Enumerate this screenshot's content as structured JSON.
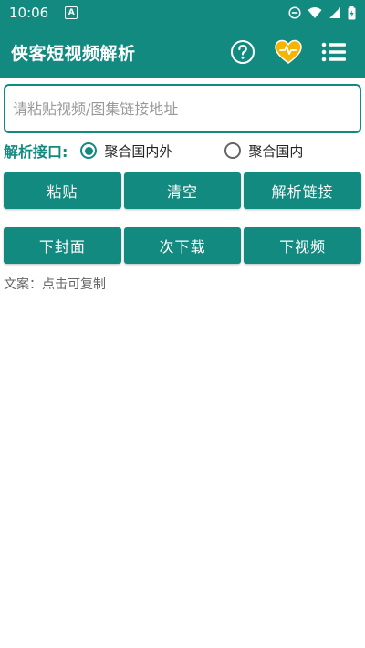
{
  "status_bar": {
    "time": "10:06",
    "a_badge": "A",
    "icons": [
      "a-icon",
      "do-not-disturb-icon",
      "wifi-icon",
      "signal-icon",
      "battery-icon"
    ]
  },
  "app_bar": {
    "title": "侠客短视频解析",
    "actions": [
      "help-icon",
      "heart-icon",
      "list-icon"
    ]
  },
  "url_input": {
    "value": "",
    "placeholder": "请粘贴视频/图集链接地址"
  },
  "api": {
    "label": "解析接口:",
    "options": [
      {
        "label": "聚合国内外",
        "selected": true
      },
      {
        "label": "聚合国内",
        "selected": false
      }
    ]
  },
  "actions_row1": {
    "paste": "粘贴",
    "clear": "清空",
    "parse": "解析链接"
  },
  "actions_row2": {
    "download_cover": "下封面",
    "download_once": "次下载",
    "download_video": "下视频"
  },
  "caption": "文案：点击可复制",
  "colors": {
    "primary": "#138a80",
    "heart": "#f5b400",
    "background": "#ffffff"
  }
}
